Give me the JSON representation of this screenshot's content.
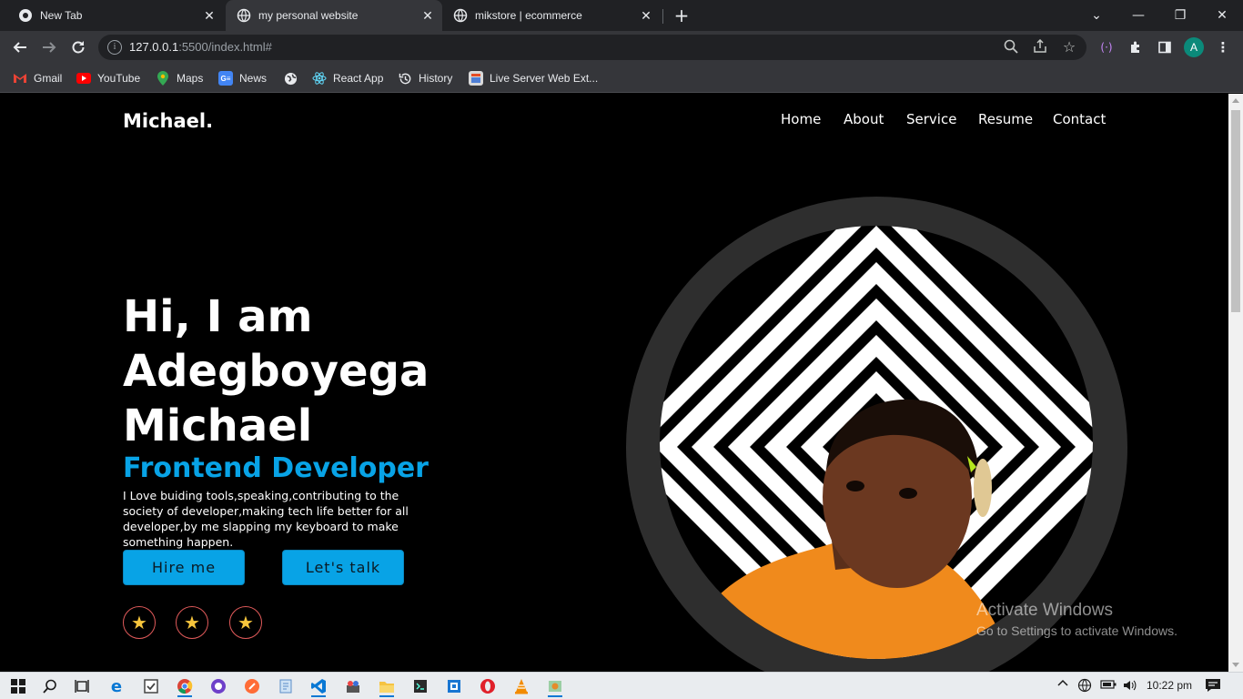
{
  "browser": {
    "tabs": [
      {
        "title": "New Tab",
        "active": false
      },
      {
        "title": "my personal website",
        "active": true
      },
      {
        "title": "mikstore | ecommerce",
        "active": false
      }
    ],
    "url_host": "127.0.0.1",
    "url_rest": ":5500/index.html#",
    "profile_initial": "A",
    "bookmarks": [
      "Gmail",
      "YouTube",
      "Maps",
      "News",
      "React App",
      "History",
      "Live Server Web Ext..."
    ]
  },
  "site": {
    "logo": "Michael.",
    "nav": [
      "Home",
      "About",
      "Service",
      "Resume",
      "Contact"
    ],
    "hero": {
      "line1": "Hi, I am",
      "line2": "Adegboyega",
      "line3": "Michael",
      "role": "Frontend Developer",
      "bio": "I Love buiding tools,speaking,contributing to the society of developer,making tech life better for all developer,by me slapping my keyboard to make something happen.",
      "hire_label": "Hire me",
      "talk_label": "Let's talk"
    },
    "social_icons": [
      "star-icon",
      "star-icon",
      "star-icon"
    ],
    "colors": {
      "accent": "#08a3e6",
      "background": "#000000",
      "social_border": "#e05a5a",
      "star": "#f6c53c"
    }
  },
  "watermark": {
    "line1": "Activate Windows",
    "line2": "Go to Settings to activate Windows."
  },
  "taskbar": {
    "time": "10:22 pm"
  }
}
